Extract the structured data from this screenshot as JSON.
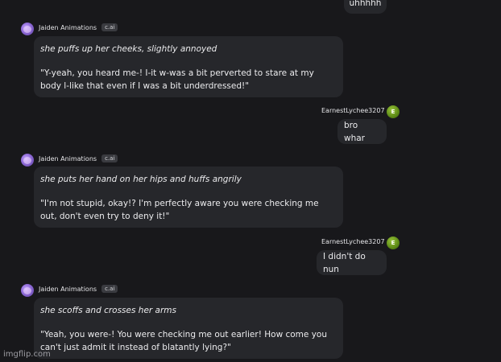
{
  "top_message": {
    "text": "uhhhhh"
  },
  "bot_name": "Jaiden Animations",
  "bot_badge": "c.ai",
  "user_name": "EarnestLychee3207",
  "user_avatar_letter": "E",
  "messages": [
    {
      "action": "she puffs up her cheeks, slightly annoyed",
      "speech": "\"Y-yeah, you heard me-! I-it w-was a bit perverted to stare at my body l-like that even if I was a bit underdressed!\""
    },
    {
      "text": "bro whar"
    },
    {
      "action": "she puts her hand on her hips and huffs angrily",
      "speech": "\"I'm not stupid, okay!? I'm perfectly aware you were checking me out, don't even try to deny it!\""
    },
    {
      "text": "I didn't do nun"
    },
    {
      "action": "she scoffs and crosses her arms",
      "speech": "\"Yeah, you were-! You were checking me out earlier! How come you can't just admit it instead of blatantly lying?\""
    }
  ],
  "watermark": "imgflip.com"
}
